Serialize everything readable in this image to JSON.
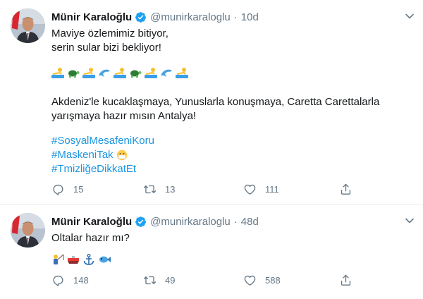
{
  "tweets": [
    {
      "author_name": "Münir Karaloğlu",
      "handle": "@munirkaraloglu",
      "separator": "·",
      "time": "10d",
      "lines": [
        "Maviye özlemimiz bitiyor,",
        "serin sular bizi bekliyor!"
      ],
      "emoji_row": [
        "swimmer",
        "turtle",
        "swimmer",
        "dolphin",
        "swimmer",
        "turtle",
        "swimmer",
        "dolphin",
        "swimmer"
      ],
      "paragraph": [
        "Akdeniz'le kucaklaşmaya, Yunuslarla konuşmaya, Caretta Carettalarla",
        "yarışmaya hazır mısın Antalya!"
      ],
      "hashtags": [
        "#SosyalMesafeniKoru",
        "#MaskeniTak",
        "#TmizliğeDikkatEt"
      ],
      "mask_emoji": "mask-face",
      "replies": "15",
      "retweets": "13",
      "likes": "111"
    },
    {
      "author_name": "Münir Karaloğlu",
      "handle": "@munirkaraloglu",
      "separator": "·",
      "time": "48d",
      "lines": [
        "Oltalar hazır mı?"
      ],
      "emoji_row": [
        "fisherman",
        "boat",
        "anchor",
        "fish"
      ],
      "replies": "148",
      "retweets": "49",
      "likes": "588"
    }
  ],
  "colors": {
    "text": "#14171a",
    "muted": "#657786",
    "link": "#1b95e0",
    "verified": "#1da1f2",
    "divider": "#e6ecf0"
  },
  "icons": [
    "reply-icon",
    "retweet-icon",
    "like-icon",
    "share-icon",
    "verified-badge-icon",
    "chevron-down-icon"
  ]
}
